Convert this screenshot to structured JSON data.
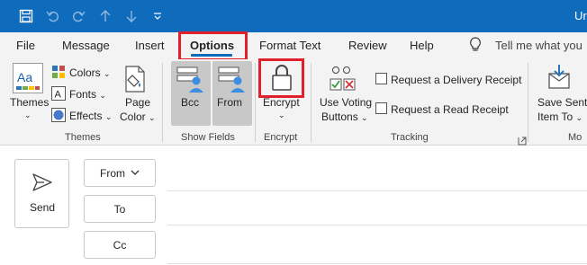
{
  "title_bar": {
    "title_fragment": "Ur",
    "quick_access": [
      "save-icon",
      "undo-icon",
      "redo-icon",
      "up-arrow-icon",
      "down-arrow-icon",
      "customize-icon"
    ]
  },
  "tabs": [
    {
      "label": "File"
    },
    {
      "label": "Message"
    },
    {
      "label": "Insert"
    },
    {
      "label": "Options",
      "active": true
    },
    {
      "label": "Format Text"
    },
    {
      "label": "Review"
    },
    {
      "label": "Help"
    }
  ],
  "tell_me": "Tell me what you",
  "ribbon": {
    "themes": {
      "themes_label": "Themes",
      "colors_label": "Colors",
      "fonts_label": "Fonts",
      "effects_label": "Effects",
      "page_color_line1": "Page",
      "page_color_line2": "Color",
      "group_label": "Themes"
    },
    "show_fields": {
      "bcc_label": "Bcc",
      "from_label": "From",
      "group_label": "Show Fields"
    },
    "encrypt": {
      "encrypt_label": "Encrypt",
      "group_label": "Encrypt"
    },
    "tracking": {
      "voting_line1": "Use Voting",
      "voting_line2": "Buttons",
      "delivery_receipt": "Request a Delivery Receipt",
      "read_receipt": "Request a Read Receipt",
      "group_label": "Tracking"
    },
    "more": {
      "save_sent_line1": "Save Sent",
      "save_sent_line2": "Item To",
      "group_label_fragment": "Mo"
    }
  },
  "compose": {
    "send_label": "Send",
    "from_label": "From",
    "to_label": "To",
    "cc_label": "Cc"
  },
  "colors": {
    "accent": "#0f6cbd",
    "highlight_box": "#e0202a",
    "ribbon_bg": "#f3f3f3",
    "selected_button_bg": "#c8c8c8"
  }
}
